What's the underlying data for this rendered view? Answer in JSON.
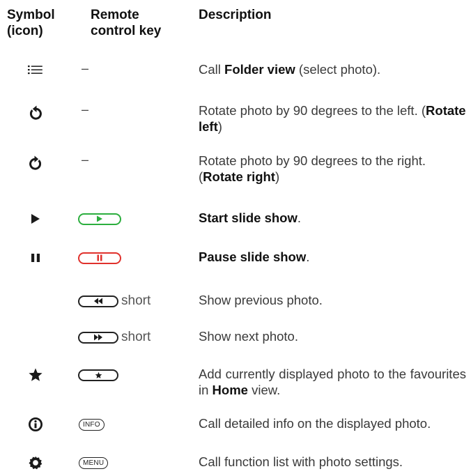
{
  "header": {
    "symbol_line1": "Symbol",
    "symbol_line2": "(icon)",
    "key_line1": "Remote",
    "key_line2": "control key",
    "description": "Description"
  },
  "rows": [
    {
      "icon": "list-icon",
      "key": "–",
      "desc": [
        "Call ",
        "Folder view",
        " (select photo)."
      ]
    },
    {
      "icon": "rotate-left-icon",
      "key": "–",
      "desc": [
        "Rotate photo by 90 degrees to the left. (",
        "Rotate left",
        ")"
      ]
    },
    {
      "icon": "rotate-right-icon",
      "key": "–",
      "desc": [
        "Rotate photo by 90 degrees to the right. (",
        "Rotate right",
        ")"
      ]
    },
    {
      "icon": "play-icon",
      "key_icon": "play-key",
      "desc": [
        "",
        "Start slide show",
        "."
      ]
    },
    {
      "icon": "pause-icon",
      "key_icon": "pause-key",
      "desc": [
        "",
        "Pause slide show",
        "."
      ]
    },
    {
      "key_icon": "rewind-key",
      "key_text": "short",
      "desc": [
        "Show previous photo."
      ]
    },
    {
      "key_icon": "fast-forward-key",
      "key_text": "short",
      "desc": [
        "Show next photo."
      ]
    },
    {
      "icon": "star-icon",
      "key_icon": "star-key",
      "desc": [
        "Add currently displayed photo to the favourites in ",
        "Home",
        " view."
      ]
    },
    {
      "icon": "info-icon",
      "key_label": "INFO",
      "desc": [
        "Call detailed info on the displayed photo."
      ]
    },
    {
      "icon": "gear-icon",
      "key_label": "MENU",
      "desc": [
        "Call function list with photo settings."
      ]
    }
  ],
  "colors": {
    "green_key": "#2cae3e",
    "red_key": "#e0312c"
  }
}
